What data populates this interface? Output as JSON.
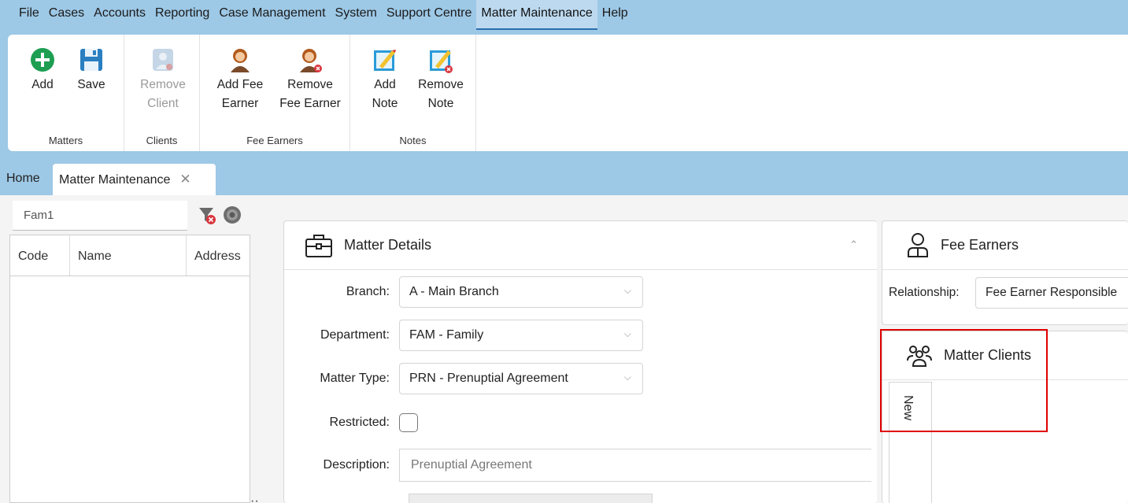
{
  "menu": {
    "items": [
      "File",
      "Cases",
      "Accounts",
      "Reporting",
      "Case Management",
      "System",
      "Support Centre",
      "Matter Maintenance",
      "Help"
    ],
    "active": "Matter Maintenance"
  },
  "ribbon": {
    "matters": {
      "label": "Matters",
      "add": "Add",
      "save": "Save"
    },
    "clients": {
      "label": "Clients",
      "remove_line1": "Remove",
      "remove_line2": "Client"
    },
    "fee_earners": {
      "label": "Fee Earners",
      "add_line1": "Add Fee",
      "add_line2": "Earner",
      "remove_line1": "Remove",
      "remove_line2": "Fee Earner"
    },
    "notes": {
      "label": "Notes",
      "add_line1": "Add",
      "add_line2": "Note",
      "remove_line1": "Remove",
      "remove_line2": "Note"
    },
    "colors": {
      "add_green": "#1e9e52",
      "save_blue": "#2a7fc1",
      "note_blue": "#2a9bd8"
    }
  },
  "tabs": {
    "home": "Home",
    "matter_maintenance": "Matter Maintenance",
    "close_glyph": "✕"
  },
  "search": {
    "value": "Fam1"
  },
  "grid": {
    "columns": [
      "Code",
      "Name",
      "Address"
    ]
  },
  "matter_details": {
    "title": "Matter Details",
    "branch_label": "Branch:",
    "branch_value": "A - Main Branch",
    "department_label": "Department:",
    "department_value": "FAM - Family",
    "matter_type_label": "Matter Type:",
    "matter_type_value": "PRN - Prenuptial Agreement",
    "restricted_label": "Restricted:",
    "restricted_checked": false,
    "description_label": "Description:",
    "description_placeholder": "Prenuptial Agreement"
  },
  "fee_earners_panel": {
    "title": "Fee Earners",
    "relationship_label": "Relationship:",
    "relationship_value": "Fee Earner Responsible"
  },
  "matter_clients_panel": {
    "title": "Matter Clients",
    "new_tab": "New"
  },
  "highlight_color": "#e00000"
}
